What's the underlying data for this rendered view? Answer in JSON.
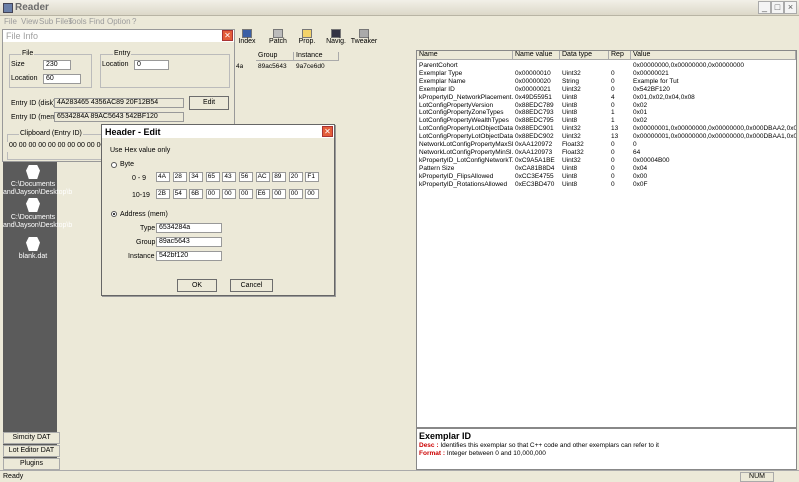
{
  "window": {
    "title": "Reader"
  },
  "menu": [
    "File",
    "View",
    "Sub Files",
    "Tools",
    "Find",
    "Option",
    "?"
  ],
  "toolbar": {
    "index": "Index",
    "patch": "Patch",
    "prop": "Prop.",
    "navig": "Navig.",
    "tweaker": "Tweaker"
  },
  "middle_table": {
    "headers": [
      "Group",
      "Instance"
    ],
    "row_prefix": "4a",
    "row": [
      "89ac5643",
      "9a7ce6d0"
    ]
  },
  "fileinfo": {
    "title": "File Info",
    "file_group": "File",
    "entry_group": "Entry",
    "size_label": "Size",
    "size_value": "230",
    "location_label": "Location",
    "file_location_value": "60",
    "entry_location_label": "Location",
    "entry_location_value": "0",
    "entry_id_disk_label": "Entry ID (disk)",
    "entry_id_disk_value": "4A283465   4356AC89   20F12B54",
    "edit_label": "Edit",
    "entry_id_mem_label": "Entry ID (mem)",
    "entry_id_mem_value": "6534284A   89AC5643   542BF120",
    "clipboard_group": "Clipboard (Entry ID)",
    "clipboard_value": "00 00 00 00 00 00 00 00 00 00"
  },
  "sidebar": {
    "items": [
      "C:\\Documents and\\Jayson\\Desktop\\b",
      "C:\\Documents and\\Jayson\\Desktop\\b",
      "blank.dat"
    ],
    "buttons": [
      "Simcity DAT",
      "Lot Editor DAT",
      "Plugins"
    ]
  },
  "dialog": {
    "title": "Header - Edit",
    "hint": "Use Hex value only",
    "byte_label": "Byte",
    "row1_label": "0 - 9",
    "row1": [
      "4A",
      "28",
      "34",
      "65",
      "43",
      "56",
      "AC",
      "89",
      "20",
      "F1"
    ],
    "row2_label": "10-19",
    "row2": [
      "2B",
      "54",
      "6B",
      "00",
      "00",
      "00",
      "E6",
      "00",
      "00",
      "00"
    ],
    "address_label": "Address (mem)",
    "type_label": "Type",
    "type_value": "6534284a",
    "group_label": "Group",
    "group_value": "89ac5643",
    "instance_label": "Instance",
    "instance_value": "542bf120",
    "ok": "OK",
    "cancel": "Cancel"
  },
  "props": {
    "headers": [
      "Name",
      "Name value",
      "Data type",
      "Rep",
      "Value"
    ],
    "rows": [
      [
        "ParentCohort",
        "",
        "",
        "",
        "0x00000000,0x00000000,0x00000000"
      ],
      [
        "Exemplar Type",
        "0x00000010",
        "Uint32",
        "0",
        "0x00000021"
      ],
      [
        "Exemplar Name",
        "0x00000020",
        "String",
        "0",
        "Example for Tut"
      ],
      [
        "Exemplar ID",
        "0x00000021",
        "Uint32",
        "0",
        "0x542BF120"
      ],
      [
        "kPropertyID_NetworkPlacement...",
        "0x49D55951",
        "Uint8",
        "4",
        "0x01,0x02,0x04,0x08"
      ],
      [
        "LotConfigPropertyVersion",
        "0x88EDC789",
        "Uint8",
        "0",
        "0x02"
      ],
      [
        "LotConfigPropertyZoneTypes",
        "0x88EDC793",
        "Uint8",
        "1",
        "0x01"
      ],
      [
        "LotConfigPropertyWealthTypes",
        "0x88EDC795",
        "Uint8",
        "1",
        "0x02"
      ],
      [
        "LotConfigPropertyLotObjectData",
        "0x88EDC901",
        "Uint32",
        "13",
        "0x00000001,0x00000000,0x00000000,0x000DBAA2,0x00..."
      ],
      [
        "LotConfigPropertyLotObjectData",
        "0x88EDC902",
        "Uint32",
        "13",
        "0x00000001,0x00000000,0x00000000,0x000DBAA1,0x00..."
      ],
      [
        "NetworkLotConfigPropertyMaxSl...",
        "0xAA120972",
        "Float32",
        "0",
        "0"
      ],
      [
        "NetworkLotConfigPropertyMinSl...",
        "0xAA120973",
        "Float32",
        "0",
        "64"
      ],
      [
        "kPropertyID_LotConfigNetworkT...",
        "0xC9A5A1BE",
        "Uint32",
        "0",
        "0x00004B00"
      ],
      [
        "Pattern Size",
        "0xCA81B8D4",
        "Uint8",
        "0",
        "0x04"
      ],
      [
        "kPropertyID_FlipsAllowed",
        "0xCC3E4755",
        "Uint8",
        "0",
        "0x00"
      ],
      [
        "kPropertyID_RotationsAllowed",
        "0xEC3BD470",
        "Uint8",
        "0",
        "0x0F"
      ]
    ]
  },
  "desc": {
    "title": "Exemplar ID",
    "desc_key": "Desc :",
    "desc_text": "Identifies this exemplar so that C++ code and other exemplars can refer to it",
    "format_key": "Format :",
    "format_text": "Integer between 0 and 10,000,000"
  },
  "status": {
    "left": "Ready",
    "num": "NUM"
  }
}
